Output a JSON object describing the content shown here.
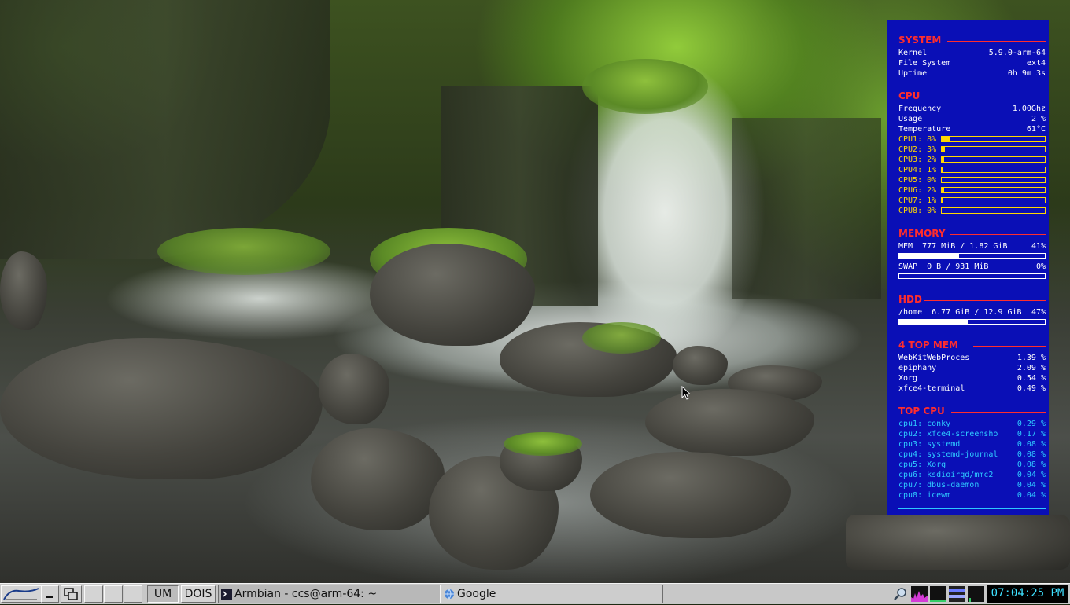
{
  "conky": {
    "system": {
      "title": "SYSTEM",
      "rows": [
        {
          "label": "Kernel",
          "value": "5.9.0-arm-64"
        },
        {
          "label": "File System",
          "value": "ext4"
        },
        {
          "label": "Uptime",
          "value": "0h 9m 3s"
        }
      ]
    },
    "cpu": {
      "title": "CPU",
      "rows": [
        {
          "label": "Frequency",
          "value": "1.00Ghz"
        },
        {
          "label": "Usage",
          "value": "2 %"
        },
        {
          "label": "Temperature",
          "value": "61°C"
        }
      ],
      "cores": [
        {
          "label": "CPU1: 8%",
          "percent": 8
        },
        {
          "label": "CPU2: 3%",
          "percent": 3
        },
        {
          "label": "CPU3: 2%",
          "percent": 2
        },
        {
          "label": "CPU4: 1%",
          "percent": 1
        },
        {
          "label": "CPU5: 0%",
          "percent": 0
        },
        {
          "label": "CPU6: 2%",
          "percent": 2
        },
        {
          "label": "CPU7: 1%",
          "percent": 1
        },
        {
          "label": "CPU8: 0%",
          "percent": 0
        }
      ]
    },
    "memory": {
      "title": "MEMORY",
      "mem": {
        "label": "MEM  777 MiB / 1.82 GiB",
        "value": "41%",
        "percent": 41
      },
      "swap": {
        "label": "SWAP  0 B / 931 MiB",
        "value": "0%",
        "percent": 0
      }
    },
    "hdd": {
      "title": "HDD",
      "home": {
        "label": "/home  6.77 GiB / 12.9 GiB",
        "value": "47%",
        "percent": 47
      }
    },
    "topmem": {
      "title": "4 TOP MEM",
      "rows": [
        {
          "label": "WebKitWebProces",
          "value": "1.39 %"
        },
        {
          "label": "epiphany",
          "value": "2.09 %"
        },
        {
          "label": "Xorg",
          "value": "0.54 %"
        },
        {
          "label": "xfce4-terminal",
          "value": "0.49 %"
        }
      ]
    },
    "topcpu": {
      "title": "TOP CPU",
      "rows": [
        {
          "label": "cpu1: conky",
          "value": "0.29 %"
        },
        {
          "label": "cpu2: xfce4-screensho",
          "value": "0.17 %"
        },
        {
          "label": "cpu3: systemd",
          "value": "0.08 %"
        },
        {
          "label": "cpu4: systemd-journal",
          "value": "0.08 %"
        },
        {
          "label": "cpu5: Xorg",
          "value": "0.08 %"
        },
        {
          "label": "cpu6: ksdioirqd/mmc2",
          "value": "0.04 %"
        },
        {
          "label": "cpu7: dbus-daemon",
          "value": "0.04 %"
        },
        {
          "label": "cpu8: icewm",
          "value": "0.04 %"
        }
      ]
    }
  },
  "taskbar": {
    "start_label": "IceWM",
    "workspaces": [
      "UM",
      "DOIS"
    ],
    "tasks": [
      {
        "title": "Armbian - ccs@arm-64: ~",
        "icon": "terminal-icon"
      },
      {
        "title": "Google",
        "icon": "globe-icon"
      }
    ],
    "clock": "07:04:25 PM"
  },
  "colors": {
    "conky_bg": "#0a0fb6",
    "section_title": "#ff2d2d",
    "cpu_bar": "#ffd800",
    "top_cpu_text": "#2ec9ff",
    "clock_text": "#3ee0ff"
  }
}
